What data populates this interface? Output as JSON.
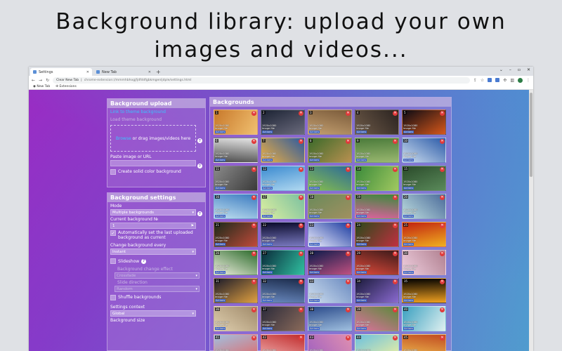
{
  "headline": {
    "line1": "Background library: upload your own",
    "line2": "images and videos..."
  },
  "browser": {
    "tabs": [
      {
        "label": "Settings",
        "active": true
      },
      {
        "label": "New Tab",
        "active": false
      }
    ],
    "newtab_symbol": "+",
    "window_controls": {
      "chevron": "⌄",
      "minimize": "–",
      "maximize": "▫",
      "close": "✕"
    },
    "address": {
      "chip": "Clear New Tab",
      "url": "chrome-extension://mmmhbhogjfjdfddfgbkmgenljdple/settings.html"
    },
    "bookmarks": [
      {
        "label": "New Tab"
      },
      {
        "label": "Extensions"
      }
    ]
  },
  "upload": {
    "title": "Background upload",
    "link_theme": "Link to theme background",
    "load_theme": "Load theme background",
    "browse": "Browse",
    "drag_text": "or drag images/videos here",
    "paste_label": "Paste image or URL",
    "solid_color": "Create solid color background"
  },
  "settings": {
    "title": "Background settings",
    "mode_label": "Mode",
    "mode_value": "Multiple backgrounds",
    "current_label": "Current background №",
    "current_value": "1",
    "auto_set": "Automatically set the last uploaded background as current",
    "change_label": "Change background every",
    "change_value": "Instant",
    "slideshow": "Slideshow",
    "effect_label": "Background change effect",
    "effect_value": "Crossfade",
    "direction_label": "Slide direction",
    "direction_value": "Random",
    "shuffle": "Shuffle backgrounds",
    "context_label": "Settings context",
    "context_value": "Global",
    "size_label": "Background size"
  },
  "backgrounds": {
    "title": "Backgrounds",
    "meta_res": "1920x1080",
    "meta_type": "Image file",
    "meta_action": "Actions",
    "delete_symbol": "✕",
    "items": [
      {
        "n": "1",
        "c1": "#c8782a",
        "c2": "#f0c070"
      },
      {
        "n": "2",
        "c1": "#1b2233",
        "c2": "#6a6a7c"
      },
      {
        "n": "3",
        "c1": "#7a5a3a",
        "c2": "#c4a070"
      },
      {
        "n": "4",
        "c1": "#2a2320",
        "c2": "#6e5a48"
      },
      {
        "n": "5",
        "c1": "#0a0a14",
        "c2": "#d6571a"
      },
      {
        "n": "6",
        "c1": "#e6e6e6",
        "c2": "#4a4a4a"
      },
      {
        "n": "7",
        "c1": "#2c5aa0",
        "c2": "#f0b040"
      },
      {
        "n": "8",
        "c1": "#3a6a2a",
        "c2": "#b89050"
      },
      {
        "n": "9",
        "c1": "#4a7a3a",
        "c2": "#9ab870"
      },
      {
        "n": "10",
        "c1": "#2a5aa8",
        "c2": "#d0e0f0"
      },
      {
        "n": "11",
        "c1": "#8a8a8a",
        "c2": "#3a3a3a"
      },
      {
        "n": "12",
        "c1": "#3a8ad0",
        "c2": "#b0d8f0"
      },
      {
        "n": "13",
        "c1": "#2a6a9a",
        "c2": "#8ac04a"
      },
      {
        "n": "14",
        "c1": "#3a8a3a",
        "c2": "#a0c860"
      },
      {
        "n": "15",
        "c1": "#2a4a2a",
        "c2": "#5a8a5a"
      },
      {
        "n": "16",
        "c1": "#3a7ac0",
        "c2": "#c0e0f0"
      },
      {
        "n": "17",
        "c1": "#7ac0a0",
        "c2": "#e0f0a0"
      },
      {
        "n": "18",
        "c1": "#6a8a5a",
        "c2": "#a09060"
      },
      {
        "n": "19",
        "c1": "#3a8a3a",
        "c2": "#e060a0"
      },
      {
        "n": "20",
        "c1": "#4a6a9a",
        "c2": "#c0e0e0"
      },
      {
        "n": "21",
        "c1": "#1a2a1a",
        "c2": "#c04a3a"
      },
      {
        "n": "22",
        "c1": "#0a0a2a",
        "c2": "#7a7ac0"
      },
      {
        "n": "23",
        "c1": "#1a3aa0",
        "c2": "#f0f0ff"
      },
      {
        "n": "24",
        "c1": "#2a4a1a",
        "c2": "#c03040"
      },
      {
        "n": "25",
        "c1": "#c02010",
        "c2": "#f0b020"
      },
      {
        "n": "26",
        "c1": "#2a6a2a",
        "c2": "#f0f0e0"
      },
      {
        "n": "27",
        "c1": "#0a2a3a",
        "c2": "#30c0a0"
      },
      {
        "n": "28",
        "c1": "#0a1a4a",
        "c2": "#c05080"
      },
      {
        "n": "29",
        "c1": "#3a1a1a",
        "c2": "#e04a3a"
      },
      {
        "n": "30",
        "c1": "#b08090",
        "c2": "#f0d0e0"
      },
      {
        "n": "31",
        "c1": "#1a1a2a",
        "c2": "#e0a040"
      },
      {
        "n": "32",
        "c1": "#1a2a4a",
        "c2": "#6a8ac0"
      },
      {
        "n": "33",
        "c1": "#6a8ac0",
        "c2": "#d0e0f0"
      },
      {
        "n": "34",
        "c1": "#1a1a3a",
        "c2": "#8a6ad0"
      },
      {
        "n": "35",
        "c1": "#000000",
        "c2": "#f0a020"
      },
      {
        "n": "36",
        "c1": "#a08a6a",
        "c2": "#e0d0b0"
      },
      {
        "n": "37",
        "c1": "#2a2a3a",
        "c2": "#8a6a5a"
      },
      {
        "n": "38",
        "c1": "#2a4a8a",
        "c2": "#a0c0e0"
      },
      {
        "n": "39",
        "c1": "#5a8a3a",
        "c2": "#e070a0"
      },
      {
        "n": "40",
        "c1": "#3aa0c0",
        "c2": "#e0f0f0"
      },
      {
        "n": "41",
        "c1": "#a0c0e0",
        "c2": "#e06a6a"
      },
      {
        "n": "42",
        "c1": "#c02a2a",
        "c2": "#f0b0b0"
      },
      {
        "n": "43",
        "c1": "#e090b0",
        "c2": "#a060c0"
      },
      {
        "n": "44",
        "c1": "#6ac0e0",
        "c2": "#f0f0a0"
      },
      {
        "n": "45",
        "c1": "#c04a20",
        "c2": "#f0c050"
      }
    ]
  }
}
